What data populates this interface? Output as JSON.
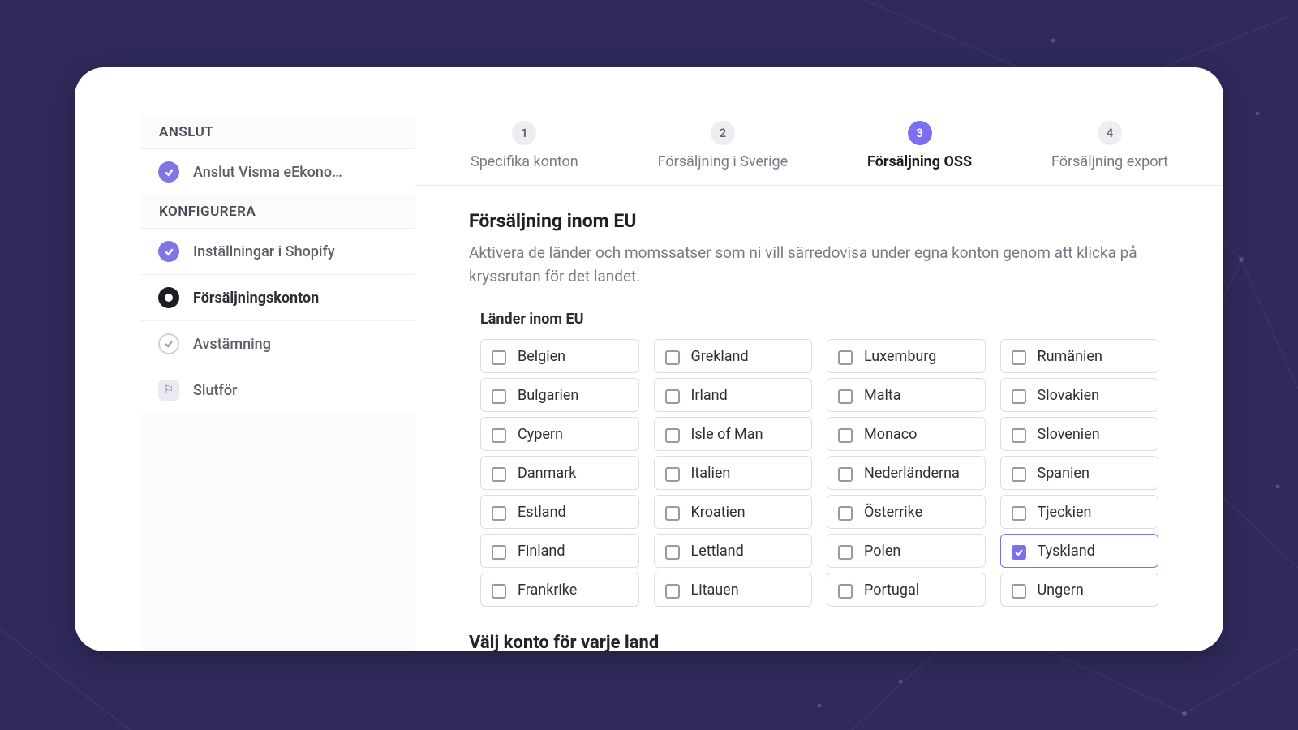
{
  "sidebar": {
    "section_connect": "ANSLUT",
    "section_configure": "KONFIGURERA",
    "items": [
      {
        "label": "Anslut Visma eEkono…",
        "state": "done"
      },
      {
        "label": "Inställningar i Shopify",
        "state": "done"
      },
      {
        "label": "Försäljningskonton",
        "state": "current"
      },
      {
        "label": "Avstämning",
        "state": "pending"
      },
      {
        "label": "Slutför",
        "state": "final"
      }
    ]
  },
  "stepper": [
    {
      "num": "1",
      "label": "Specifika konton",
      "current": false
    },
    {
      "num": "2",
      "label": "Försäljning i Sverige",
      "current": false
    },
    {
      "num": "3",
      "label": "Försäljning OSS",
      "current": true
    },
    {
      "num": "4",
      "label": "Försäljning export",
      "current": false
    }
  ],
  "content": {
    "heading": "Försäljning inom EU",
    "description": "Aktivera de länder och momssatser som ni vill särredovisa under egna konton genom att klicka på kryssrutan för det landet.",
    "countries_label": "Länder inom EU",
    "next_heading": "Välj konto för varje land"
  },
  "countries": [
    {
      "name": "Belgien",
      "checked": false
    },
    {
      "name": "Bulgarien",
      "checked": false
    },
    {
      "name": "Cypern",
      "checked": false
    },
    {
      "name": "Danmark",
      "checked": false
    },
    {
      "name": "Estland",
      "checked": false
    },
    {
      "name": "Finland",
      "checked": false
    },
    {
      "name": "Frankrike",
      "checked": false
    },
    {
      "name": "Grekland",
      "checked": false
    },
    {
      "name": "Irland",
      "checked": false
    },
    {
      "name": "Isle of Man",
      "checked": false
    },
    {
      "name": "Italien",
      "checked": false
    },
    {
      "name": "Kroatien",
      "checked": false
    },
    {
      "name": "Lettland",
      "checked": false
    },
    {
      "name": "Litauen",
      "checked": false
    },
    {
      "name": "Luxemburg",
      "checked": false
    },
    {
      "name": "Malta",
      "checked": false
    },
    {
      "name": "Monaco",
      "checked": false
    },
    {
      "name": "Nederländerna",
      "checked": false
    },
    {
      "name": "Österrike",
      "checked": false
    },
    {
      "name": "Polen",
      "checked": false
    },
    {
      "name": "Portugal",
      "checked": false
    },
    {
      "name": "Rumänien",
      "checked": false
    },
    {
      "name": "Slovakien",
      "checked": false
    },
    {
      "name": "Slovenien",
      "checked": false
    },
    {
      "name": "Spanien",
      "checked": false
    },
    {
      "name": "Tjeckien",
      "checked": false
    },
    {
      "name": "Tyskland",
      "checked": true
    },
    {
      "name": "Ungern",
      "checked": false
    }
  ]
}
